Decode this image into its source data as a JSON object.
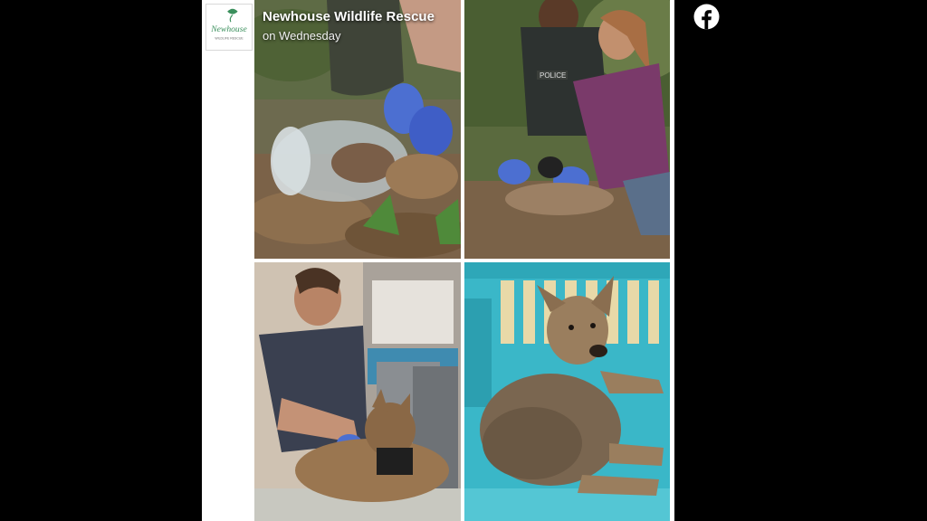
{
  "header": {
    "page_name": "Newhouse Wildlife Rescue",
    "post_time": "on Wednesday",
    "logo_text": "Newhouse",
    "logo_subtext": "WILDLIFE RESCUE"
  },
  "photo_grid": {
    "items": [
      {
        "name": "coyote-jar-photo"
      },
      {
        "name": "rescuers-kneeling-photo"
      },
      {
        "name": "vet-harness-photo"
      },
      {
        "name": "coyote-crate-photo"
      }
    ]
  },
  "badge_text": "POLICE",
  "icons": {
    "facebook": "facebook-icon"
  },
  "colors": {
    "background": "#000000",
    "facebook_icon": "#ffffff",
    "logo_green": "#3a8f5c",
    "crate_teal": "#3ab7c8",
    "glove_blue": "#4c6fd1"
  }
}
